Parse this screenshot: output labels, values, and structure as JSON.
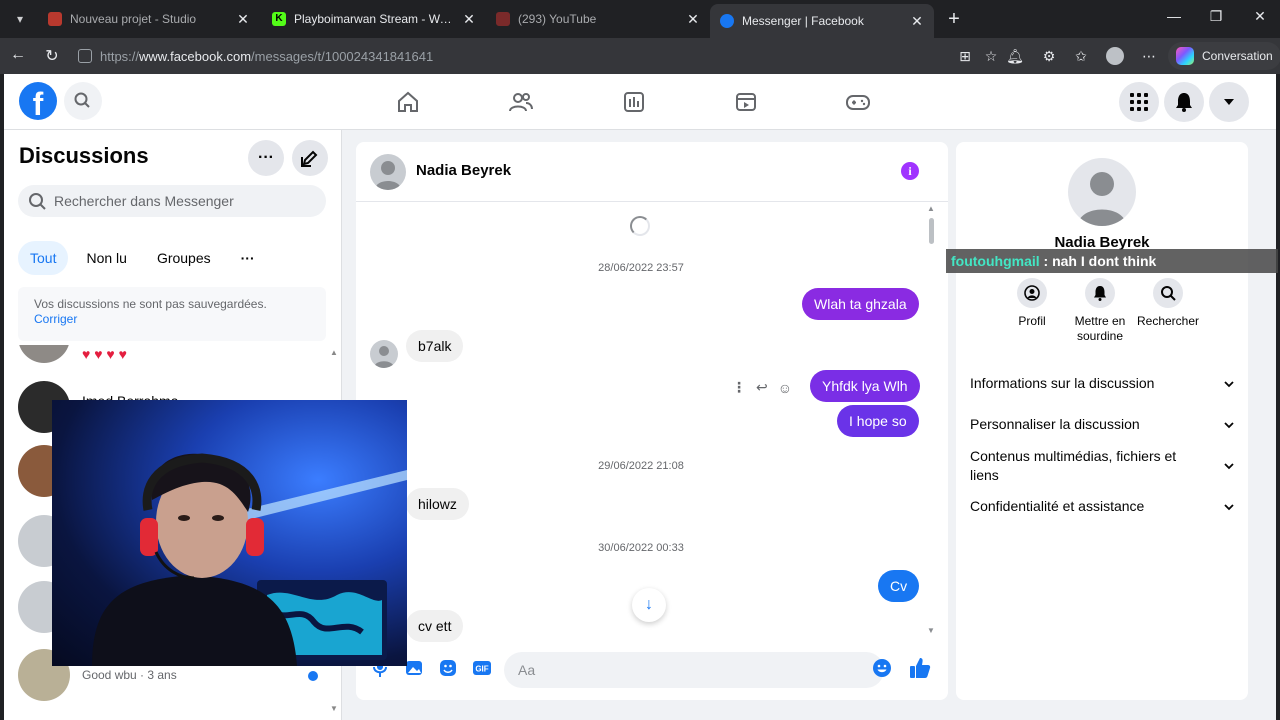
{
  "browser": {
    "tabs": [
      {
        "title": "Nouveau projet - Studio",
        "active": false
      },
      {
        "title": "Playboimarwan Stream - Watch Li",
        "active": false
      },
      {
        "title": "(293) YouTube",
        "active": false
      },
      {
        "title": "Messenger | Facebook",
        "active": true
      }
    ],
    "url_prefix": "https://",
    "url_host": "www.facebook.com",
    "url_path": "/messages/t/100024341841641",
    "copilot_label": "Conversation"
  },
  "sidebar": {
    "title": "Discussions",
    "search_placeholder": "Rechercher dans Messenger",
    "filters": [
      "Tout",
      "Non lu",
      "Groupes"
    ],
    "notice_text": "Vos discussions ne sont pas sauvegardées.",
    "notice_link": "Corriger",
    "conversations": [
      {
        "name": "Imed Berrahma",
        "snippet": ""
      },
      {
        "name": "",
        "snippet": "Good wbu · 3 ans"
      }
    ]
  },
  "chat": {
    "contact_name": "Nadia Beyrek",
    "timestamps": [
      "28/06/2022 23:57",
      "29/06/2022 21:08",
      "30/06/2022 00:33"
    ],
    "messages": [
      {
        "text": "Wlah ta ghzala",
        "dir": "out"
      },
      {
        "text": "b7alk",
        "dir": "in"
      },
      {
        "text": "Yhfdk lya Wlh",
        "dir": "out"
      },
      {
        "text": "I hope so",
        "dir": "out"
      },
      {
        "text": "hilowz",
        "dir": "in"
      },
      {
        "text": "Cv",
        "dir": "out"
      },
      {
        "text": "cv ett",
        "dir": "in"
      }
    ],
    "composer_placeholder": "Aa"
  },
  "info_panel": {
    "name": "Nadia Beyrek",
    "actions": [
      "Profil",
      "Mettre en sourdine",
      "Rechercher"
    ],
    "sections": [
      "Informations sur la discussion",
      "Personnaliser la discussion",
      "Contenus multimédias, fichiers et liens",
      "Confidentialité et assistance"
    ]
  },
  "stream_chat": {
    "user": "foutouhgmail",
    "message": " : nah I dont think"
  },
  "colors": {
    "accent": "#1877f2",
    "bubble_purple": "#8a2be2",
    "bubble_blue": "#1877f2",
    "info_purple": "#a033ff"
  }
}
